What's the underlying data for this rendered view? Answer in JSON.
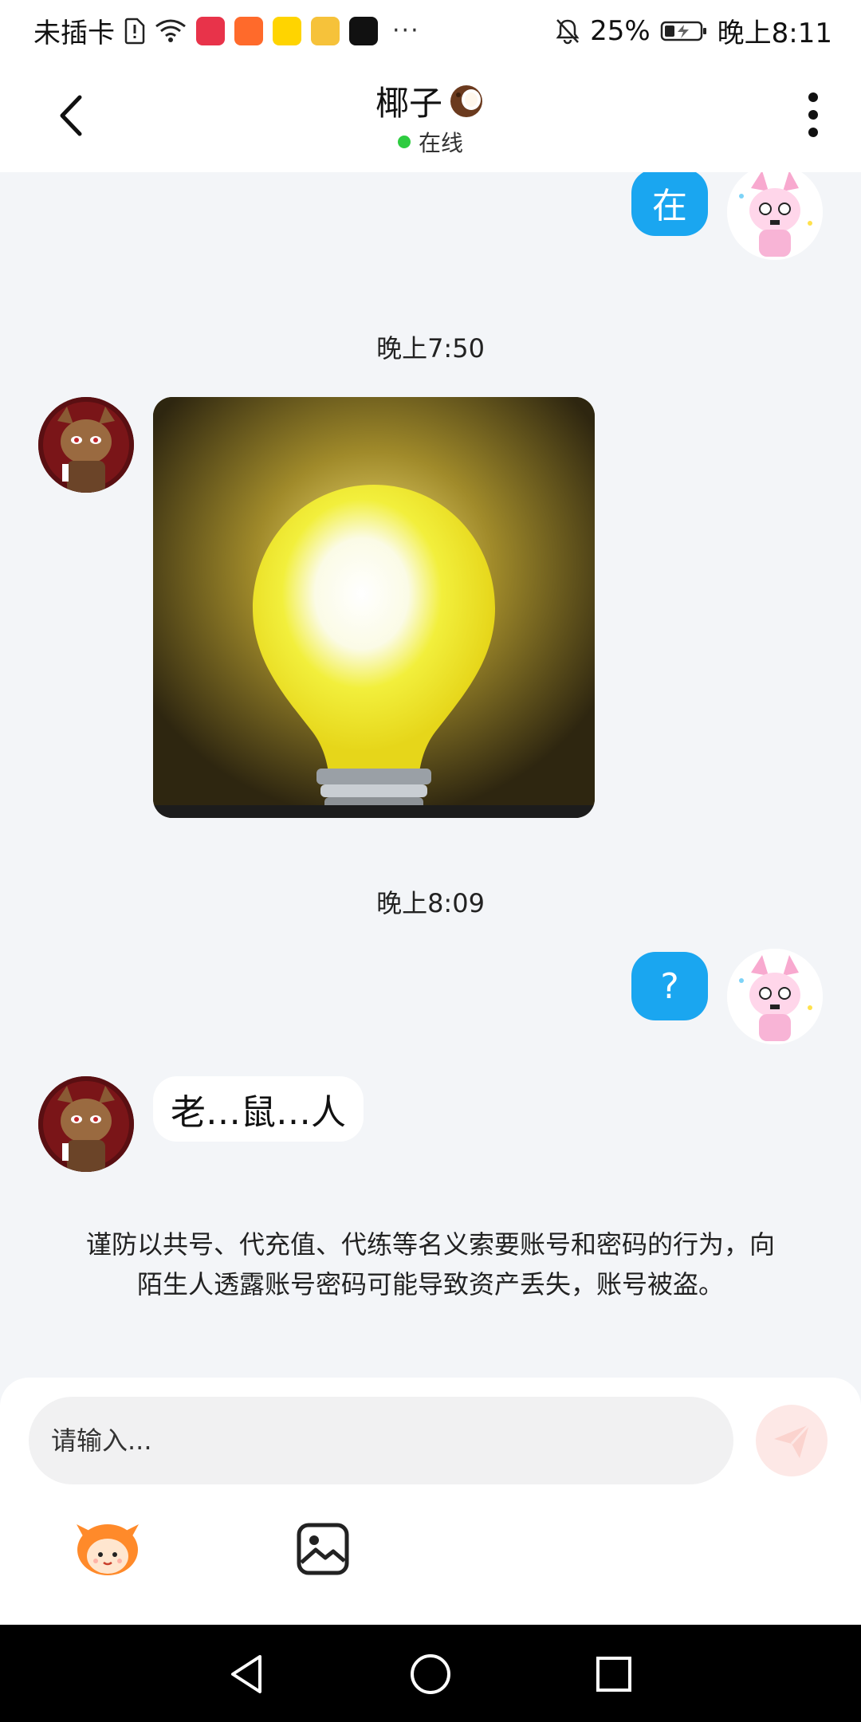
{
  "status_bar": {
    "carrier": "未插卡",
    "overflow_dots": "···",
    "battery": "25%",
    "time": "晚上8:11",
    "apps": [
      "app-icon-book",
      "app-icon-red",
      "app-icon-yellow",
      "app-icon-video",
      "app-icon-tiktok"
    ]
  },
  "header": {
    "title": "椰子",
    "status": "在线"
  },
  "messages": {
    "msg1_text": "在",
    "time1": "晚上7:50",
    "time2": "晚上8:09",
    "msg3_text": "?",
    "msg4_text": "老…鼠…人"
  },
  "warning_text": "谨防以共号、代充值、代练等名义索要账号和密码的行为，向陌生人透露账号密码可能导致资产丢失，账号被盗。",
  "composer": {
    "placeholder": "请输入..."
  },
  "colors": {
    "my_bubble": "#1aa6f0",
    "online": "#2ecc40",
    "send_button": "#fde8e6"
  },
  "icons": {
    "back": "back-arrow-icon",
    "more": "more-vertical-icon",
    "send": "send-icon",
    "emoji": "emoji-mascot-icon",
    "image": "image-icon"
  }
}
